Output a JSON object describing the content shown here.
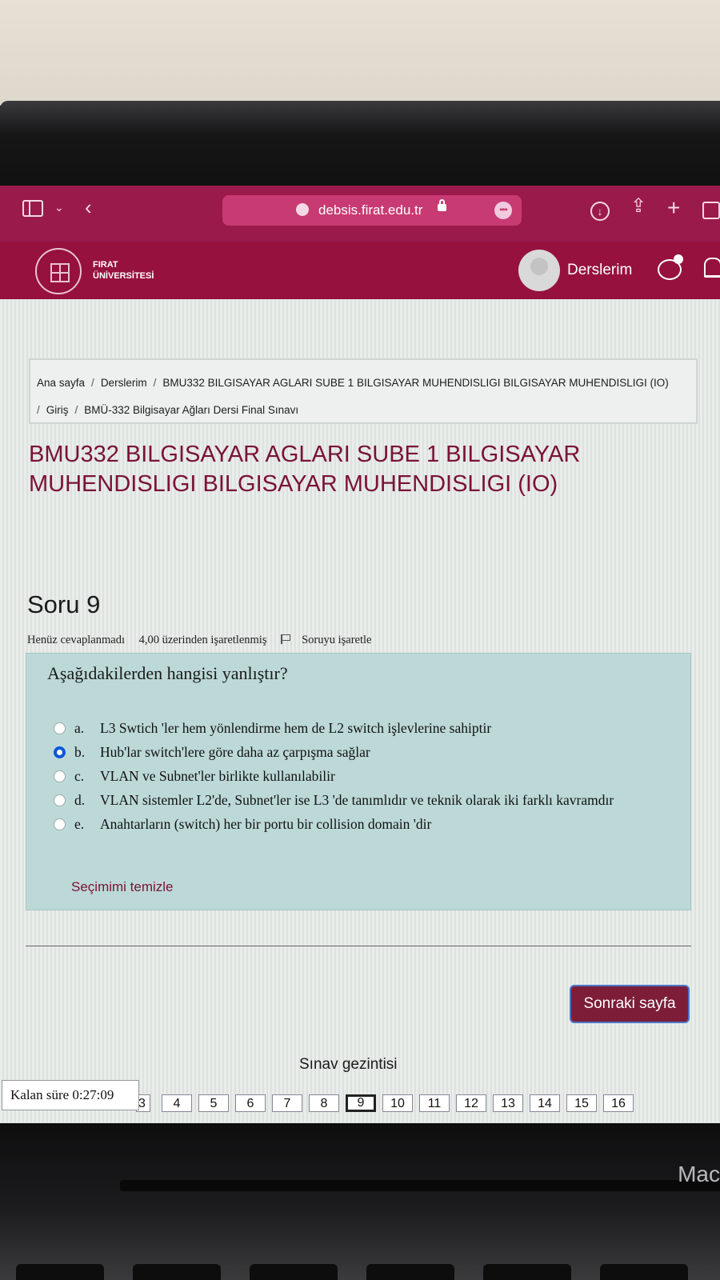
{
  "browser": {
    "url": "debsis.firat.edu.tr"
  },
  "site": {
    "university_line1": "FIRAT",
    "university_line2": "ÜNİVERSİTESİ",
    "nav_label": "Derslerim"
  },
  "breadcrumb": {
    "items": [
      "Ana sayfa",
      "Derslerim",
      "BMU332 BILGISAYAR AGLARI SUBE 1 BILGISAYAR MUHENDISLIGI BILGISAYAR MUHENDISLIGI (IO)",
      "Giriş",
      "BMÜ-332 Bilgisayar Ağları Dersi Final Sınavı"
    ]
  },
  "course_title": "BMU332 BILGISAYAR AGLARI SUBE 1 BILGISAYAR MUHENDISLIGI BILGISAYAR MUHENDISLIGI (IO)",
  "question": {
    "title": "Soru 9",
    "status": "Henüz cevaplanmadı",
    "marks": "4,00 üzerinden işaretlenmiş",
    "flag_label": "Soruyu işaretle",
    "text": "Aşağıdakilerden hangisi yanlıştır?",
    "answers": [
      {
        "letter": "a.",
        "text": "L3 Swtich 'ler hem yönlendirme hem de L2 switch işlevlerine sahiptir",
        "selected": false
      },
      {
        "letter": "b.",
        "text": "Hub'lar switch'lere göre daha az çarpışma sağlar",
        "selected": true
      },
      {
        "letter": "c.",
        "text": "VLAN ve Subnet'ler birlikte kullanılabilir",
        "selected": false
      },
      {
        "letter": "d.",
        "text": "VLAN sistemler L2'de, Subnet'ler ise L3 'de tanımlıdır ve teknik olarak iki farklı kavramdır",
        "selected": false
      },
      {
        "letter": "e.",
        "text": "Anahtarların (switch) her bir portu bir collision domain 'dir",
        "selected": false
      }
    ],
    "clear_label": "Seçimimi temizle"
  },
  "next_button": "Sonraki sayfa",
  "quiz_nav": {
    "title": "Sınav gezintisi",
    "timer": "Kalan süre 0:27:09",
    "numbers": [
      "3",
      "4",
      "5",
      "6",
      "7",
      "8",
      "9",
      "10",
      "11",
      "12",
      "13",
      "14",
      "15",
      "16"
    ],
    "current": "9"
  },
  "device_label": "Mac"
}
